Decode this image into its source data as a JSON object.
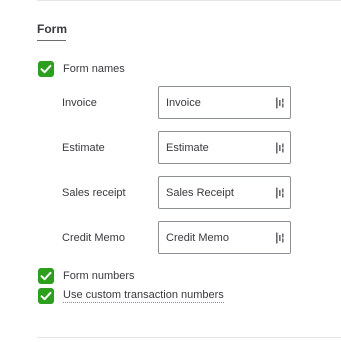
{
  "section": {
    "title": "Form"
  },
  "form_names": {
    "checkbox_label": "Form names",
    "checked": true,
    "fields": [
      {
        "label": "Invoice",
        "value": "Invoice",
        "icon": "text-cursor-icon"
      },
      {
        "label": "Estimate",
        "value": "Estimate",
        "icon": "text-cursor-icon"
      },
      {
        "label": "Sales receipt",
        "value": "Sales Receipt",
        "icon": "text-cursor-icon"
      },
      {
        "label": "Credit Memo",
        "value": "Credit Memo",
        "icon": "text-cursor-icon"
      }
    ]
  },
  "form_numbers": {
    "checkbox_label": "Form numbers",
    "checked": true
  },
  "custom_numbers": {
    "checkbox_label": "Use custom transaction numbers",
    "checked": true
  },
  "colors": {
    "checkbox_green": "#2ca01c",
    "text": "#393a3d",
    "border": "#8d9096"
  }
}
